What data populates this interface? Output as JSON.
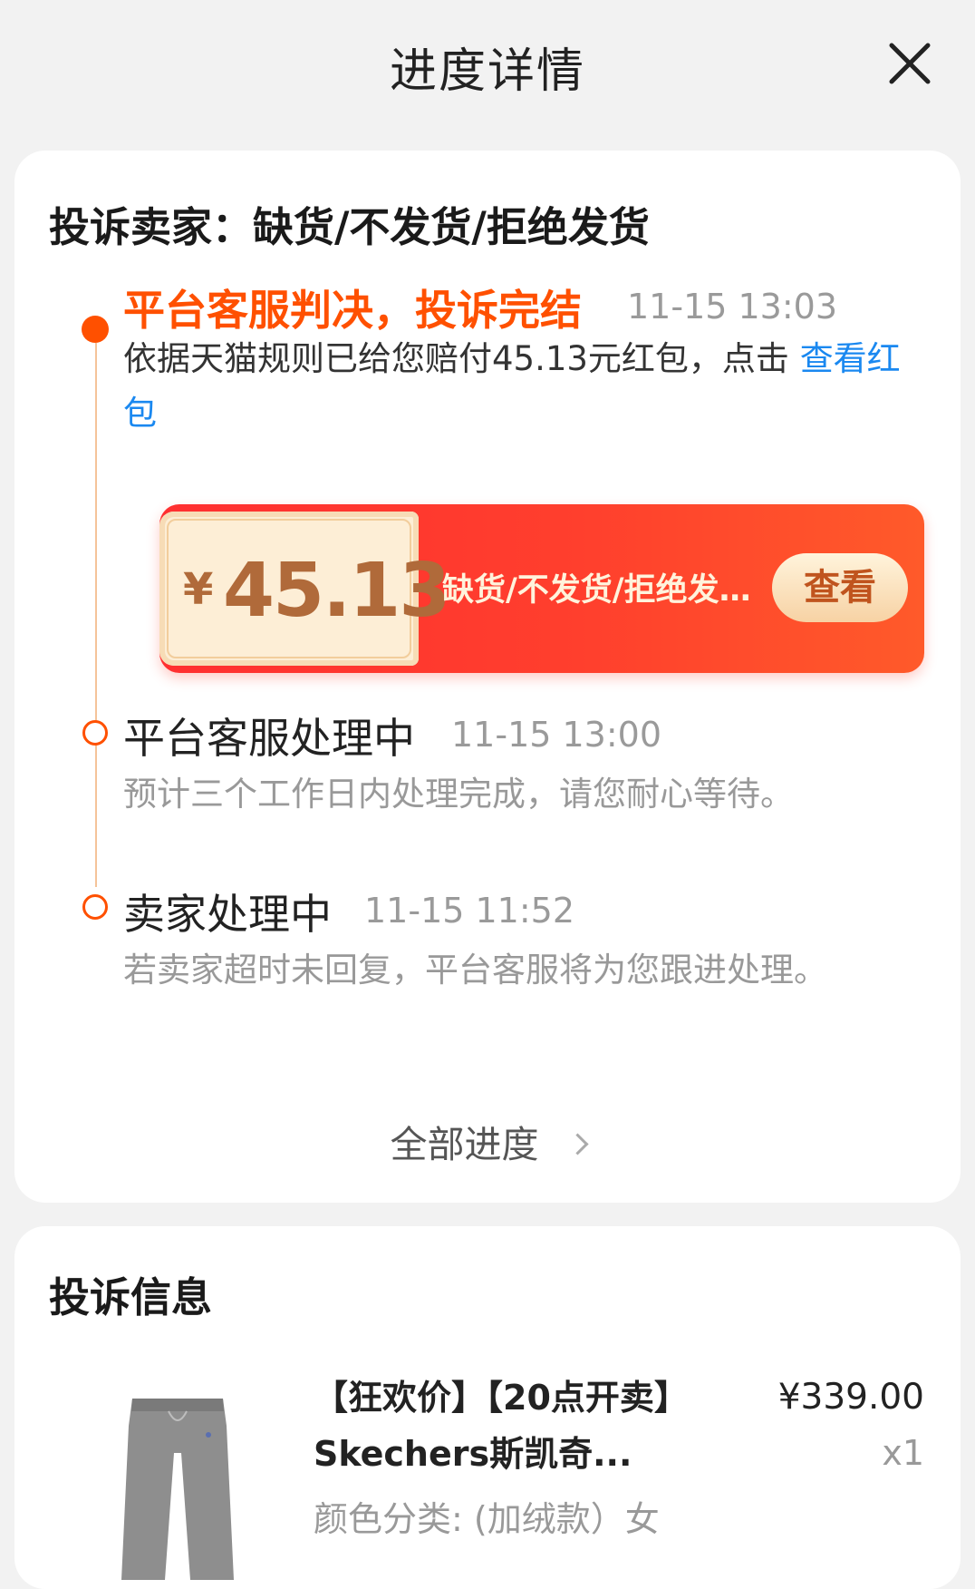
{
  "header": {
    "title": "进度详情"
  },
  "summary": {
    "title": "投诉卖家：缺货/不发货/拒绝发货"
  },
  "timeline": [
    {
      "title": "平台客服判决，投诉完结",
      "time": "11-15 13:03",
      "desc_prefix": "依据天猫规则已给您赔付45.13元红包，点击 ",
      "desc_link": "查看红包"
    },
    {
      "title": "平台客服处理中",
      "time": "11-15 13:00",
      "desc": "预计三个工作日内处理完成，请您耐心等待。"
    },
    {
      "title": "卖家处理中",
      "time": "11-15 11:52",
      "desc": "若卖家超时未回复，平台客服将为您跟进处理。"
    }
  ],
  "red_packet": {
    "currency": "¥",
    "amount": "45.13",
    "desc": "缺货/不发货/拒绝发...",
    "button": "查看"
  },
  "all_progress_label": "全部进度",
  "complaint_info": {
    "title": "投诉信息",
    "product": {
      "title": "【狂欢价】【20点开卖】Skechers斯凯奇...",
      "attr": "颜色分类: (加绒款）女",
      "price": "¥339.00",
      "qty": "x1"
    }
  },
  "colors": {
    "accent": "#ff5000",
    "link": "#1a88f0",
    "packet_red": "#ff3a2e",
    "coupon_bg": "#fdeed6"
  }
}
